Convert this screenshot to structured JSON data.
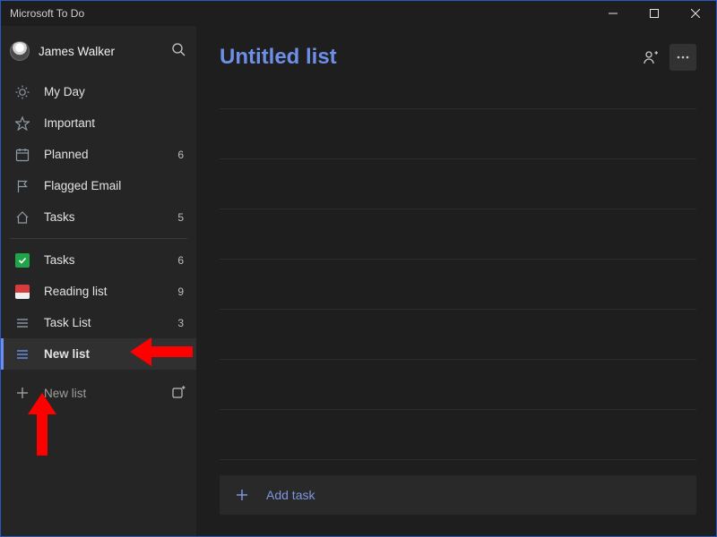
{
  "window": {
    "title": "Microsoft To Do"
  },
  "account": {
    "name": "James Walker"
  },
  "sidebar": {
    "smart": [
      {
        "label": "My Day",
        "icon": "sun",
        "count": ""
      },
      {
        "label": "Important",
        "icon": "star",
        "count": ""
      },
      {
        "label": "Planned",
        "icon": "calendar",
        "count": "6"
      },
      {
        "label": "Flagged Email",
        "icon": "flag",
        "count": ""
      },
      {
        "label": "Tasks",
        "icon": "home",
        "count": "5"
      }
    ],
    "lists": [
      {
        "label": "Tasks",
        "icon": "check",
        "count": "6",
        "selected": false
      },
      {
        "label": "Reading list",
        "icon": "readbox",
        "count": "9",
        "selected": false
      },
      {
        "label": "Task List",
        "icon": "list",
        "count": "3",
        "selected": false
      },
      {
        "label": "New list",
        "icon": "list",
        "count": "",
        "selected": true
      }
    ],
    "new_list_label": "New list"
  },
  "main": {
    "title": "Untitled list",
    "add_task_label": "Add task"
  },
  "colors": {
    "accent": "#6e8fe8",
    "annotation": "#ff0000"
  }
}
